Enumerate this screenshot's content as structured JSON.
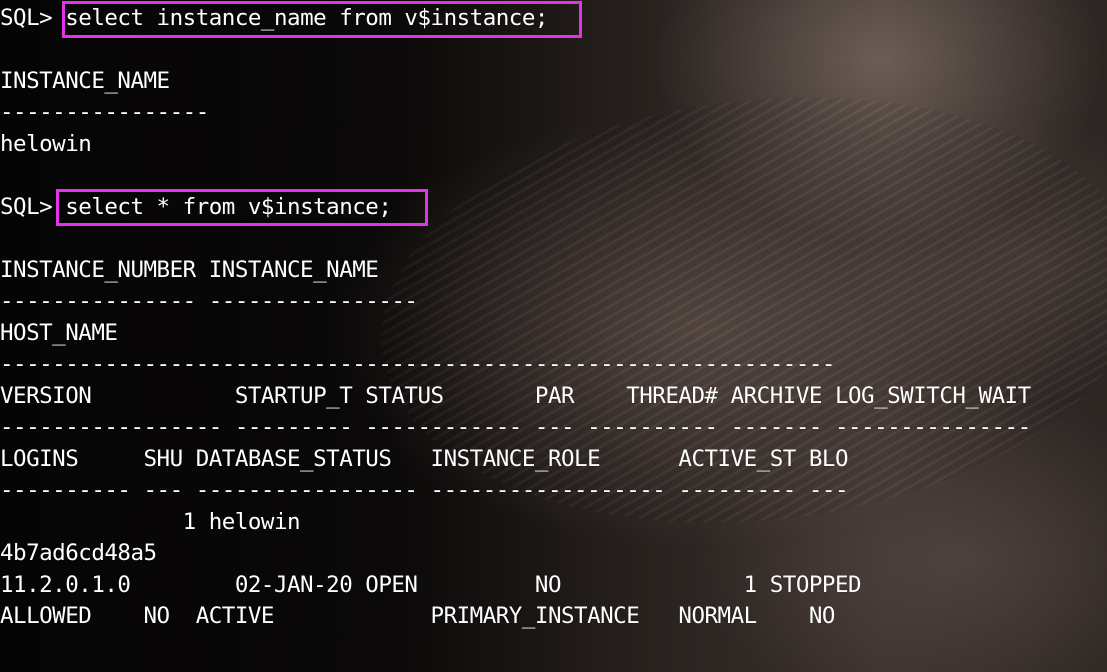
{
  "prompt": "SQL>",
  "commands": [
    "select instance_name from v$instance;",
    "select * from v$instance;"
  ],
  "result1": {
    "header": "INSTANCE_NAME",
    "separator": "----------------",
    "value": "helowin"
  },
  "result2": {
    "header_lines": [
      "INSTANCE_NUMBER INSTANCE_NAME",
      "--------------- ----------------",
      "HOST_NAME",
      "----------------------------------------------------------------",
      "VERSION           STARTUP_T STATUS       PAR    THREAD# ARCHIVE LOG_SWITCH_WAIT",
      "----------------- --------- ------------ --- ---------- ------- ---------------",
      "LOGINS     SHU DATABASE_STATUS   INSTANCE_ROLE      ACTIVE_ST BLO",
      "---------- --- ----------------- ------------------ --------- ---"
    ],
    "row_lines": [
      "              1 helowin",
      "4b7ad6cd48a5",
      "11.2.0.1.0        02-JAN-20 OPEN         NO              1 STOPPED",
      "ALLOWED    NO  ACTIVE            PRIMARY_INSTANCE   NORMAL    NO"
    ]
  },
  "colors": {
    "text": "#ffffff",
    "highlight_box": "#e233e6"
  }
}
